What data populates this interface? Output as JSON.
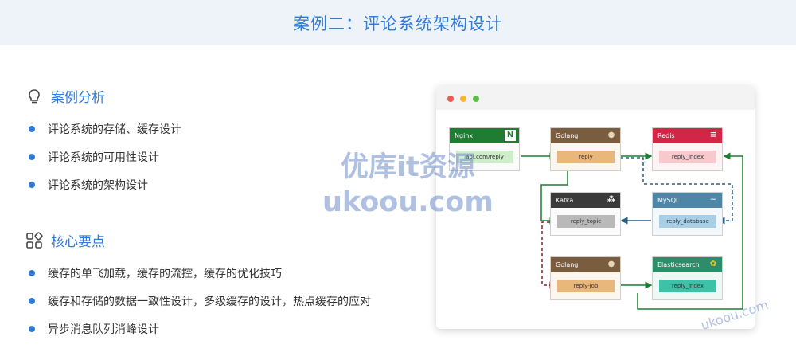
{
  "header": {
    "title": "案例二：评论系统架构设计"
  },
  "section1": {
    "title": "案例分析",
    "icon": "lightbulb-icon",
    "items": [
      "评论系统的存储、缓存设计",
      "评论系统的可用性设计",
      "评论系统的架构设计"
    ]
  },
  "section2": {
    "title": "核心要点",
    "icon": "apps-grid-icon",
    "items": [
      "缓存的单飞加载，缓存的流控，缓存的优化技巧",
      "缓存和存储的数据一致性设计，多级缓存的设计，热点缓存的应对",
      "异步消息队列消峰设计"
    ]
  },
  "diagram": {
    "nodes": {
      "nginx": {
        "title": "Nginx",
        "label": "api.com/reply",
        "badge": "N",
        "color": "#1e7d32"
      },
      "golang1": {
        "title": "Golang",
        "label": "reply",
        "color": "#7a5c3e"
      },
      "redis": {
        "title": "Redis",
        "label": "reply_index",
        "color": "#d32545"
      },
      "kafka": {
        "title": "Kafka",
        "label": "reply_topic",
        "color": "#3a3a3a"
      },
      "mysql": {
        "title": "MySQL",
        "label": "reply_database",
        "color": "#4f86a8"
      },
      "golang2": {
        "title": "Golang",
        "label": "reply-job",
        "color": "#7a5c3e"
      },
      "es": {
        "title": "Elasticsearch",
        "label": "reply_index",
        "color": "#2d8c6a"
      }
    }
  },
  "watermark": {
    "line1": "优库it资源",
    "line2": "ukoou.com",
    "corner": "ukoou.com"
  },
  "colors": {
    "accent": "#2f7bd6",
    "header_bg": "#eef3fa"
  }
}
